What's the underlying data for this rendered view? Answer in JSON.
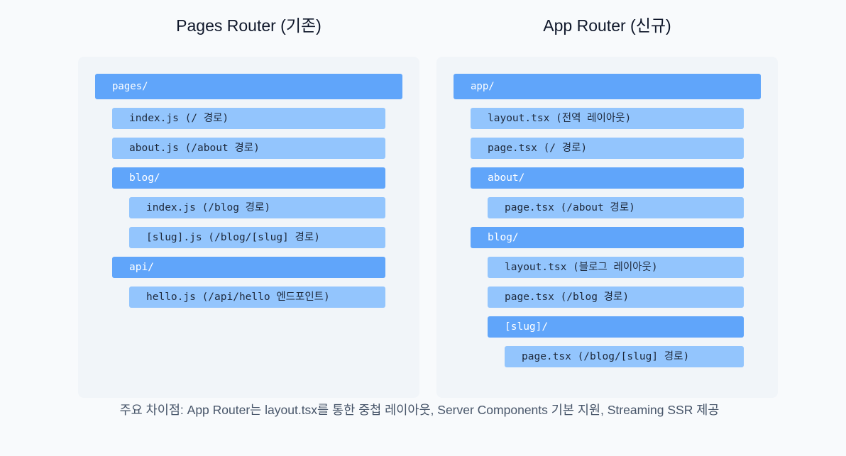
{
  "left": {
    "title": "Pages Router (기존)",
    "root": "pages/",
    "items": [
      {
        "label": "index.js (/ 경로)",
        "kind": "file",
        "depth": 1
      },
      {
        "label": "about.js (/about 경로)",
        "kind": "file",
        "depth": 1
      },
      {
        "label": "blog/",
        "kind": "folder",
        "depth": 1
      },
      {
        "label": "index.js (/blog 경로)",
        "kind": "file",
        "depth": 2
      },
      {
        "label": "[slug].js (/blog/[slug] 경로)",
        "kind": "file",
        "depth": 2
      },
      {
        "label": "api/",
        "kind": "folder",
        "depth": 1
      },
      {
        "label": "hello.js (/api/hello 엔드포인트)",
        "kind": "file",
        "depth": 2
      }
    ]
  },
  "right": {
    "title": "App Router (신규)",
    "root": "app/",
    "items": [
      {
        "label": "layout.tsx (전역 레이아웃)",
        "kind": "file",
        "depth": 1
      },
      {
        "label": "page.tsx (/ 경로)",
        "kind": "file",
        "depth": 1
      },
      {
        "label": "about/",
        "kind": "folder",
        "depth": 1
      },
      {
        "label": "page.tsx (/about 경로)",
        "kind": "file",
        "depth": 2
      },
      {
        "label": "blog/",
        "kind": "folder",
        "depth": 1
      },
      {
        "label": "layout.tsx (블로그 레이아웃)",
        "kind": "file",
        "depth": 2
      },
      {
        "label": "page.tsx (/blog 경로)",
        "kind": "file",
        "depth": 2
      },
      {
        "label": "[slug]/",
        "kind": "folder",
        "depth": 2
      },
      {
        "label": "page.tsx (/blog/[slug] 경로)",
        "kind": "file",
        "depth": 3
      }
    ]
  },
  "footer": "주요 차이점: App Router는 layout.tsx를 통한 중첩 레이아웃, Server Components 기본 지원, Streaming SSR 제공",
  "colors": {
    "background": "#f8fafc",
    "panel": "#f1f5f9",
    "folder": "#60a5fa",
    "file": "#93c5fd",
    "title_text": "#0f172a",
    "footer_text": "#475569"
  }
}
